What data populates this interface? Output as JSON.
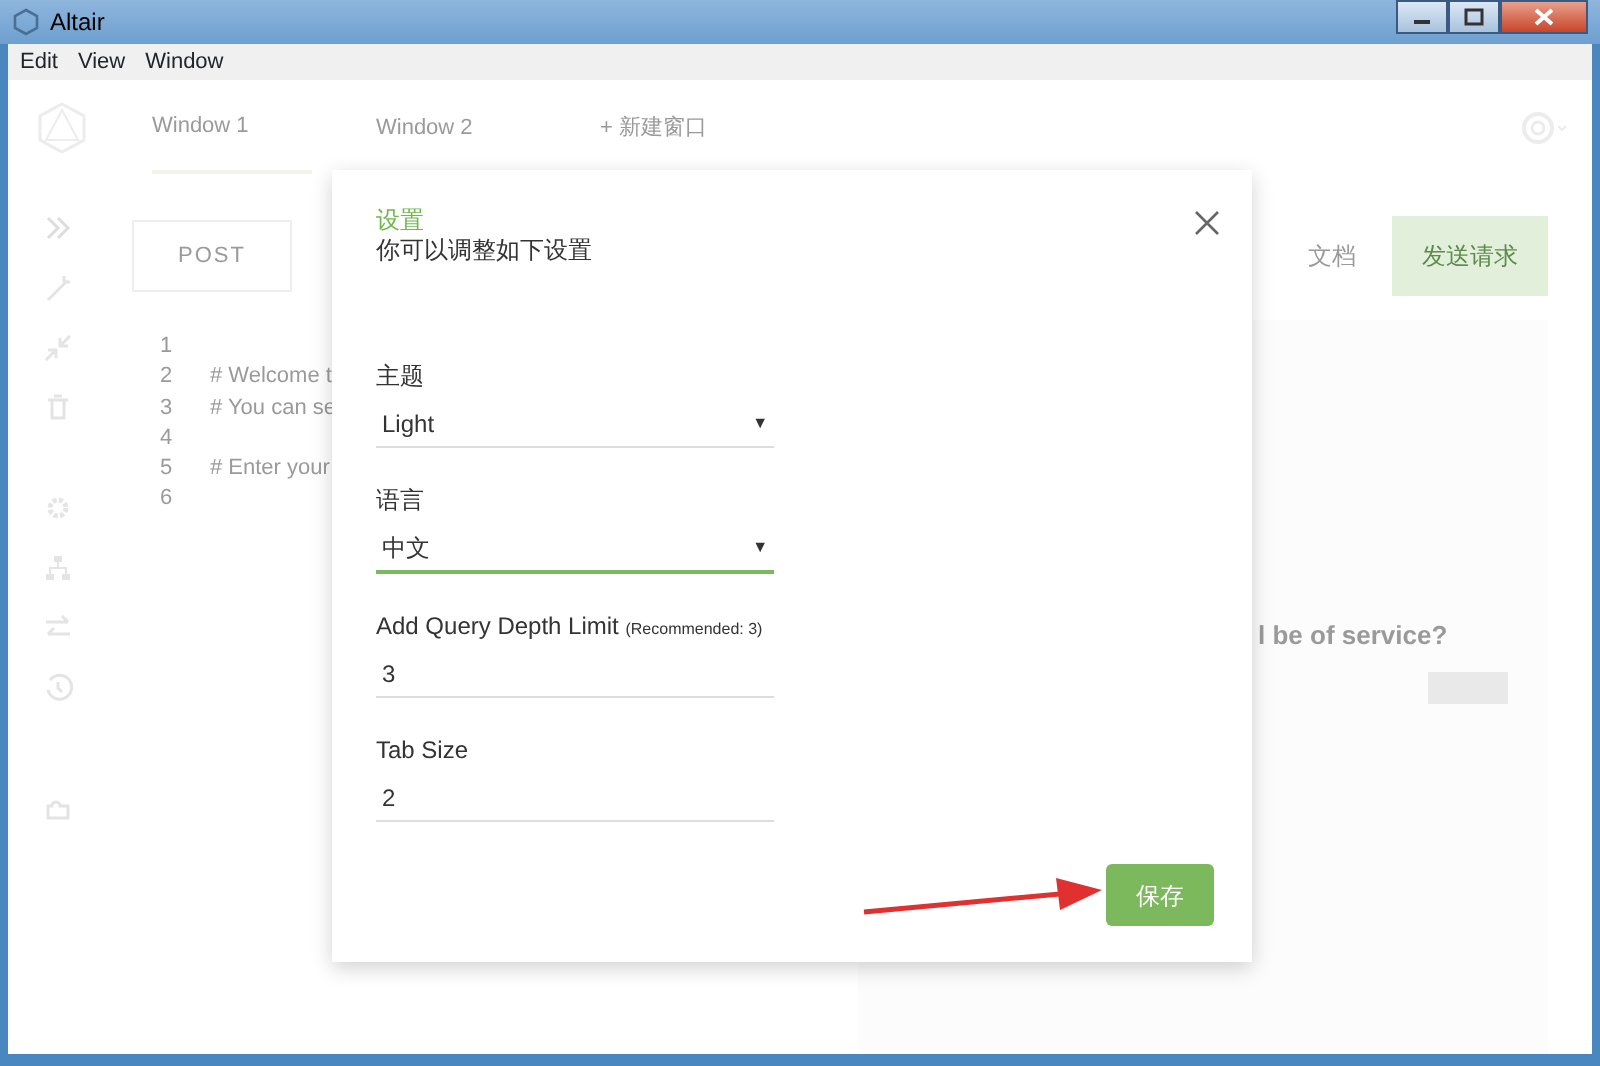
{
  "window": {
    "title": "Altair"
  },
  "menu": [
    "Edit",
    "View",
    "Window"
  ],
  "app": {
    "tabs": [
      {
        "label": "Window 1",
        "selected": true
      },
      {
        "label": "Window 2",
        "selected": false
      }
    ],
    "add_tab": "+ 新建窗口",
    "method": "POST",
    "docs": "文档",
    "send": "发送请求",
    "editor": [
      {
        "line": "1"
      },
      {
        "line": "2",
        "text": "# Welcome t"
      },
      {
        "line": "3",
        "text": "# You can se"
      },
      {
        "line": "4"
      },
      {
        "line": "5",
        "text": "# Enter your"
      },
      {
        "line": "6"
      }
    ],
    "response_hint": "l be of service?"
  },
  "dialog": {
    "title": "设置",
    "subtitle": "你可以调整如下设置",
    "fields": [
      {
        "kind": "select",
        "label": "主题",
        "value": "Light",
        "caret": "▼",
        "focused": false
      },
      {
        "kind": "select",
        "label": "语言",
        "value": "中文",
        "caret": "▼",
        "focused": true
      },
      {
        "kind": "input",
        "label": "Add Query Depth Limit",
        "hint": "(Recommended: 3)",
        "value": "3",
        "focused": false
      },
      {
        "kind": "input",
        "label": "Tab Size",
        "value": "2",
        "focused": false
      }
    ],
    "save": "保存"
  }
}
